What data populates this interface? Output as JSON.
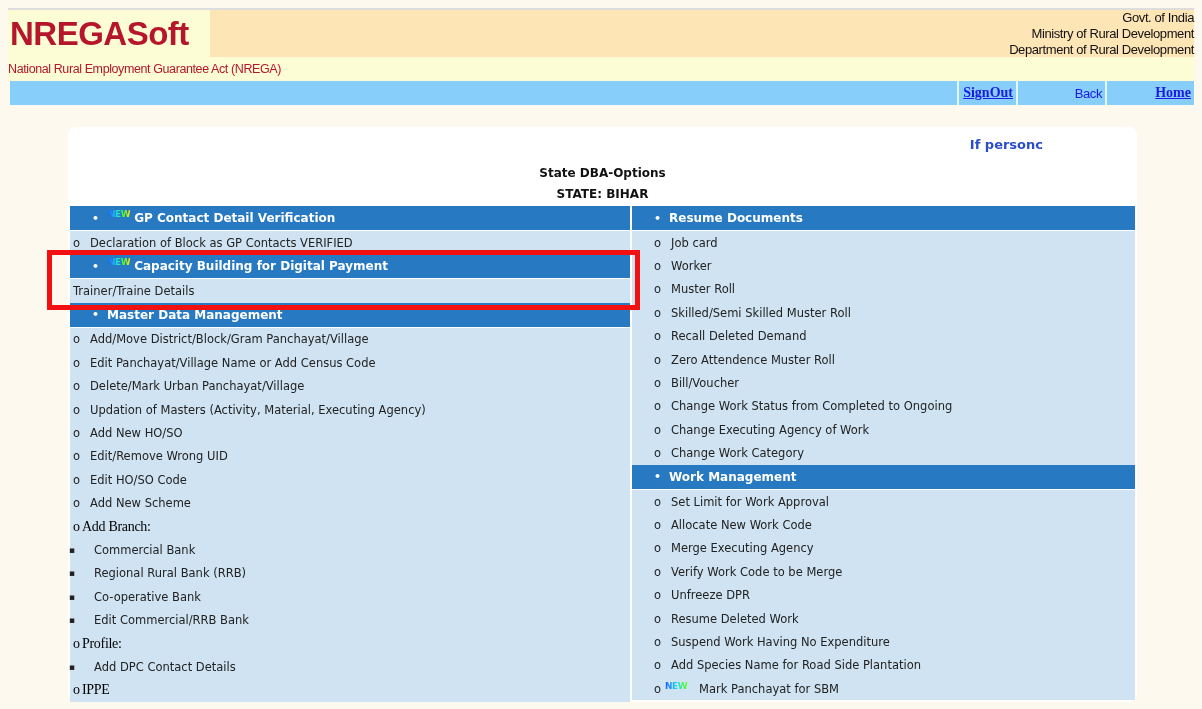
{
  "header": {
    "logo": "NREGASoft",
    "subtitle": "National Rural Employment Guarantee Act (NREGA)",
    "org_lines": [
      "Govt. of India",
      "Ministry of Rural Development",
      "Department of Rural Development"
    ]
  },
  "nav": [
    {
      "label": "SignOut",
      "kind": "underlined"
    },
    {
      "label": "Back",
      "kind": "plain"
    },
    {
      "label": "Home",
      "kind": "underlined"
    }
  ],
  "notice": "If personc",
  "title": "State DBA-Options",
  "state": "STATE: BIHAR",
  "columns": [
    [
      {
        "marker": "•",
        "badge": "NEW",
        "title": "GP Contact Detail Verification",
        "items": [
          {
            "kind": "item",
            "marker": "o",
            "text": "Declaration of Block as GP Contacts VERIFIED"
          }
        ]
      },
      {
        "marker": "•",
        "badge": "NEW",
        "highlighted": true,
        "title": "Capacity Building for Digital Payment",
        "items": [
          {
            "kind": "item",
            "text": "Trainer/Traine Details"
          }
        ]
      },
      {
        "marker": "•",
        "title": "Master Data Management",
        "items": [
          {
            "kind": "item",
            "marker": "o",
            "text": "Add/Move District/Block/Gram Panchayat/Village"
          },
          {
            "kind": "item",
            "marker": "o",
            "text": "Edit Panchayat/Village Name or Add Census Code"
          },
          {
            "kind": "item",
            "marker": "o",
            "text": "Delete/Mark Urban Panchayat/Village"
          },
          {
            "kind": "item",
            "marker": "o",
            "text": "Updation of Masters (Activity, Material, Executing Agency)"
          },
          {
            "kind": "item",
            "marker": "o",
            "text": "Add New HO/SO"
          },
          {
            "kind": "item",
            "marker": "o",
            "text": "Edit/Remove Wrong UID"
          },
          {
            "kind": "item",
            "marker": "o",
            "text": "Edit HO/SO Code"
          },
          {
            "kind": "item",
            "marker": "o",
            "text": "Add New Scheme"
          },
          {
            "kind": "group",
            "marker": "o",
            "text": "Add Branch:"
          },
          {
            "kind": "subitem",
            "marker": "▪",
            "text": "Commercial Bank"
          },
          {
            "kind": "subitem",
            "marker": "▪",
            "text": "Regional Rural Bank (RRB)"
          },
          {
            "kind": "subitem",
            "marker": "▪",
            "text": "Co-operative Bank"
          },
          {
            "kind": "subitem",
            "marker": "▪",
            "text": "Edit Commercial/RRB Bank"
          },
          {
            "kind": "group",
            "marker": "o",
            "text": "Profile:"
          },
          {
            "kind": "subitem",
            "marker": "▪",
            "text": "Add DPC Contact Details"
          },
          {
            "kind": "group",
            "marker": "o",
            "text": "IPPE"
          }
        ]
      }
    ],
    [
      {
        "marker": "•",
        "title": "Resume Documents",
        "items": [
          {
            "kind": "item",
            "marker": "o",
            "text": "Job card"
          },
          {
            "kind": "item",
            "marker": "o",
            "text": "Worker"
          },
          {
            "kind": "item",
            "marker": "o",
            "text": "Muster Roll"
          },
          {
            "kind": "item",
            "marker": "o",
            "text": "Skilled/Semi Skilled Muster Roll"
          },
          {
            "kind": "item",
            "marker": "o",
            "text": "Recall Deleted Demand"
          },
          {
            "kind": "item",
            "marker": "o",
            "text": "Zero Attendence Muster Roll"
          },
          {
            "kind": "item",
            "marker": "o",
            "text": "Bill/Voucher"
          },
          {
            "kind": "item",
            "marker": "o",
            "text": "Change Work Status from Completed to Ongoing"
          },
          {
            "kind": "item",
            "marker": "o",
            "text": "Change Executing Agency of Work"
          },
          {
            "kind": "item",
            "marker": "o",
            "text": "Change Work Category"
          }
        ]
      },
      {
        "marker": "•",
        "title": "Work Management",
        "items": [
          {
            "kind": "item",
            "marker": "o",
            "text": "Set Limit for Work Approval"
          },
          {
            "kind": "item",
            "marker": "o",
            "text": "Allocate New Work Code"
          },
          {
            "kind": "item",
            "marker": "o",
            "text": "Merge Executing Agency"
          },
          {
            "kind": "item",
            "marker": "o",
            "text": "Verify Work Code to be Merge"
          },
          {
            "kind": "item",
            "marker": "o",
            "text": "Unfreeze DPR"
          },
          {
            "kind": "item",
            "marker": "o",
            "text": "Resume Deleted Work"
          },
          {
            "kind": "item",
            "marker": "o",
            "text": "Suspend Work Having No Expenditure"
          },
          {
            "kind": "item",
            "marker": "o",
            "text": "Add Species Name for Road Side Plantation"
          },
          {
            "kind": "item",
            "marker": "o",
            "badge": "NEW",
            "text": "Mark Panchayat for SBM"
          }
        ]
      }
    ]
  ]
}
